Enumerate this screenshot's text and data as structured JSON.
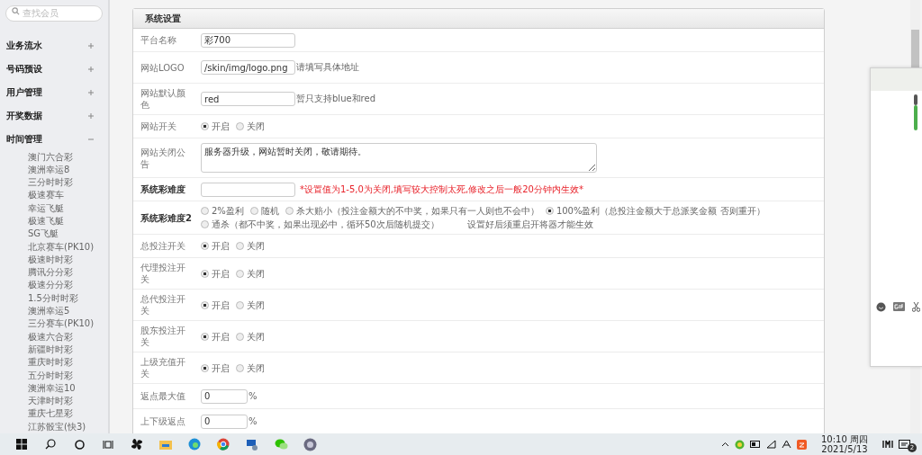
{
  "sidebar": {
    "search": {
      "placeholder": "查找会员"
    },
    "groups": [
      {
        "label": "业务流水",
        "expanded": false
      },
      {
        "label": "号码预设",
        "expanded": false
      },
      {
        "label": "用户管理",
        "expanded": false
      },
      {
        "label": "开奖数据",
        "expanded": false
      },
      {
        "label": "时间管理",
        "expanded": true,
        "children": [
          "澳门六合彩",
          "澳洲幸运8",
          "三分时时彩",
          "极速赛车",
          "幸运飞艇",
          "极速飞艇",
          "SG飞艇",
          "北京赛车(PK10)",
          "极速时时彩",
          "腾讯分分彩",
          "极速分分彩",
          "1.5分时时彩",
          "澳洲幸运5",
          "三分赛车(PK10)",
          "极速六合彩",
          "新疆时时彩",
          "重庆时时彩",
          "五分时时彩",
          "澳洲幸运10",
          "天津时时彩",
          "重庆七星彩",
          "江苏骰宝(快3)"
        ]
      }
    ]
  },
  "panel": {
    "title": "系统设置",
    "rows": [
      {
        "kind": "text",
        "label": "平台名称",
        "value": "彩700"
      },
      {
        "kind": "text",
        "label": "网站LOGO",
        "value": "/skin/img/logo.png",
        "hint": "请填写具体地址"
      },
      {
        "kind": "text",
        "label": "网站默认颜色",
        "value": "red",
        "hint": "暂只支持blue和red"
      },
      {
        "kind": "radio",
        "label": "网站开关",
        "options": [
          {
            "label": "开启",
            "selected": true
          },
          {
            "label": "关闭",
            "selected": false
          }
        ]
      },
      {
        "kind": "textarea",
        "label": "网站关闭公告",
        "value": "服务器升级，网站暂时关闭，敬请期待。"
      },
      {
        "kind": "text",
        "label": "系统彩难度",
        "emphasis": true,
        "value": "",
        "warning": "*设置值为1-5,0为关闭,填写较大控制太死,修改之后一般20分钟内生效*"
      },
      {
        "kind": "radio",
        "label": "系统彩难度2",
        "emphasis": true,
        "options": [
          {
            "label": "2%盈利",
            "selected": false
          },
          {
            "label": "随机",
            "selected": false
          },
          {
            "label": "杀大赔小（投注金额大的不中奖，如果只有一人则也不会中）",
            "selected": false
          },
          {
            "label": "100%盈利（总投注金额大于总派奖金额 否则重开）",
            "selected": true
          },
          {
            "label": "通杀（都不中奖，如果出现必中，循环50次后随机提交）",
            "selected": false
          }
        ],
        "note": "设置好后须重启开将器才能生效"
      },
      {
        "kind": "radio",
        "label": "总投注开关",
        "options": [
          {
            "label": "开启",
            "selected": true
          },
          {
            "label": "关闭",
            "selected": false
          }
        ]
      },
      {
        "kind": "radio",
        "label": "代理投注开关",
        "options": [
          {
            "label": "开启",
            "selected": true
          },
          {
            "label": "关闭",
            "selected": false
          }
        ]
      },
      {
        "kind": "radio",
        "label": "总代投注开关",
        "options": [
          {
            "label": "开启",
            "selected": true
          },
          {
            "label": "关闭",
            "selected": false
          }
        ]
      },
      {
        "kind": "radio",
        "label": "股东投注开关",
        "options": [
          {
            "label": "开启",
            "selected": true
          },
          {
            "label": "关闭",
            "selected": false
          }
        ]
      },
      {
        "kind": "radio",
        "label": "上级充值开关",
        "options": [
          {
            "label": "开启",
            "selected": true
          },
          {
            "label": "关闭",
            "selected": false
          }
        ]
      },
      {
        "kind": "number",
        "label": "返点最大值",
        "value": "0",
        "suffix": "%"
      },
      {
        "kind": "number",
        "label": "上下级返点",
        "value": "0",
        "suffix": "%"
      }
    ]
  },
  "taskbar": {
    "time": "10:10 周四",
    "date": "2021/5/13",
    "notifications": "2"
  }
}
